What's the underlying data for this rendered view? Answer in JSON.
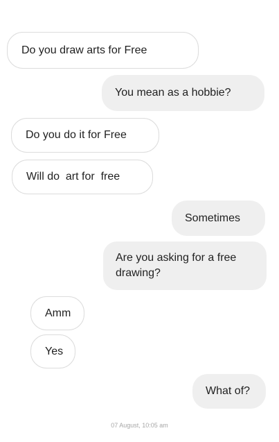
{
  "chat": {
    "messages": [
      {
        "direction": "incoming",
        "text": "Do you draw arts for Free"
      },
      {
        "direction": "outgoing",
        "text": "You mean as a hobbie?"
      },
      {
        "direction": "incoming",
        "text": "Do you do it for Free"
      },
      {
        "direction": "incoming",
        "text": "Will do  art for  free"
      },
      {
        "direction": "outgoing",
        "text": "Sometimes"
      },
      {
        "direction": "outgoing",
        "text": "Are you asking for a free drawing?"
      },
      {
        "direction": "incoming",
        "text": "Amm"
      },
      {
        "direction": "incoming",
        "text": "Yes"
      },
      {
        "direction": "outgoing",
        "text": "What of?"
      }
    ],
    "timestamp": "07 August, 10:05 am"
  }
}
